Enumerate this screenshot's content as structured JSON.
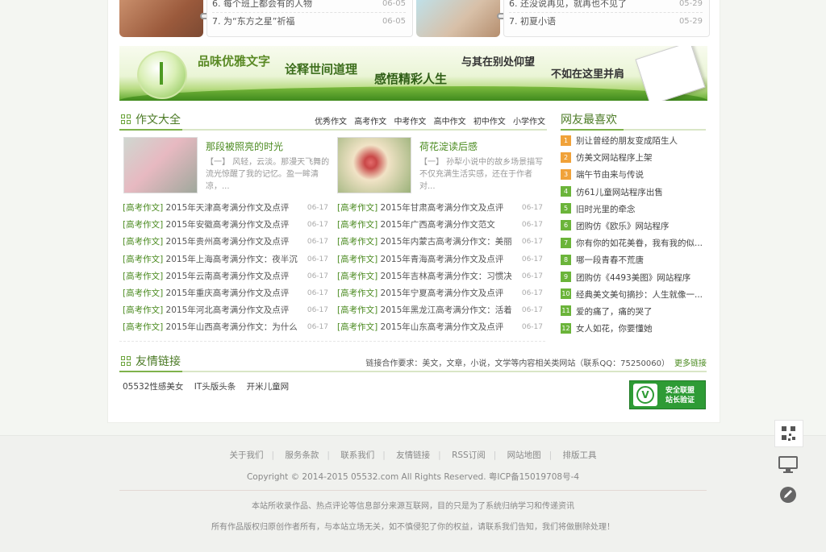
{
  "top_lists": [
    {
      "items": [
        {
          "index": "6.",
          "title": "每个班上都会有的人物",
          "date": "06-05"
        },
        {
          "index": "7.",
          "title": "为“东方之星”祈福",
          "date": "06-05"
        }
      ]
    },
    {
      "items": [
        {
          "index": "6.",
          "title": "还没说再见，就再也不见了",
          "date": "05-29"
        },
        {
          "index": "7.",
          "title": "初夏小语",
          "date": "05-29"
        }
      ]
    }
  ],
  "banner": {
    "line1": "品味优雅文字",
    "line2": "诠释世间道理",
    "line3": "感悟精彩人生",
    "line4": "与其在别处仰望",
    "line5": "不如在这里并肩"
  },
  "essay": {
    "title": "作文大全",
    "tabs": [
      "优秀作文",
      "高考作文",
      "中考作文",
      "高中作文",
      "初中作文",
      "小学作文"
    ],
    "features": [
      {
        "title": "那段被照亮的时光",
        "desc": "【一】 风轻，云淡。那漫天飞舞的流光惊醒了我的记忆。盈一眸清凉，..."
      },
      {
        "title": "荷花淀读后感",
        "desc": "【一】 孙犁小说中的故乡场景描写不仅充满生活实感，还在于作者对..."
      }
    ],
    "left_list": [
      {
        "cat": "[高考作文]",
        "title": "2015年天津高考满分作文及点评",
        "date": "06-17"
      },
      {
        "cat": "[高考作文]",
        "title": "2015年安徽高考满分作文及点评",
        "date": "06-17"
      },
      {
        "cat": "[高考作文]",
        "title": "2015年贵州高考满分作文及点评",
        "date": "06-17"
      },
      {
        "cat": "[高考作文]",
        "title": "2015年上海高考满分作文：夜半沉",
        "date": "06-17"
      },
      {
        "cat": "[高考作文]",
        "title": "2015年云南高考满分作文及点评",
        "date": "06-17"
      },
      {
        "cat": "[高考作文]",
        "title": "2015年重庆高考满分作文及点评",
        "date": "06-17"
      },
      {
        "cat": "[高考作文]",
        "title": "2015年河北高考满分作文及点评",
        "date": "06-17"
      },
      {
        "cat": "[高考作文]",
        "title": "2015年山西高考满分作文：为什么",
        "date": "06-17"
      }
    ],
    "right_list": [
      {
        "cat": "[高考作文]",
        "title": "2015年甘肃高考满分作文及点评",
        "date": "06-17"
      },
      {
        "cat": "[高考作文]",
        "title": "2015年广西高考满分作文范文",
        "date": "06-17"
      },
      {
        "cat": "[高考作文]",
        "title": "2015年内蒙古高考满分作文：美丽",
        "date": "06-17"
      },
      {
        "cat": "[高考作文]",
        "title": "2015年青海高考满分作文及点评",
        "date": "06-17"
      },
      {
        "cat": "[高考作文]",
        "title": "2015年吉林高考满分作文：习惯决",
        "date": "06-17"
      },
      {
        "cat": "[高考作文]",
        "title": "2015年宁夏高考满分作文及点评",
        "date": "06-17"
      },
      {
        "cat": "[高考作文]",
        "title": "2015年黑龙江高考满分作文：活着",
        "date": "06-17"
      },
      {
        "cat": "[高考作文]",
        "title": "2015年山东高考满分作文及点评",
        "date": "06-17"
      }
    ]
  },
  "favorites": {
    "title": "网友最喜欢",
    "items": [
      {
        "num": "1",
        "title": "别让曾经的朋友变成陌生人",
        "color": "#f0a23a"
      },
      {
        "num": "2",
        "title": "仿美文网站程序上架",
        "color": "#f0a23a"
      },
      {
        "num": "3",
        "title": "端午节由来与传说",
        "color": "#f0a23a"
      },
      {
        "num": "4",
        "title": "仿61儿童网站程序出售",
        "color": "#6bb43a"
      },
      {
        "num": "5",
        "title": "旧时光里的牵念",
        "color": "#6bb43a"
      },
      {
        "num": "6",
        "title": "团购仿《欧乐》网站程序",
        "color": "#6bb43a"
      },
      {
        "num": "7",
        "title": "你有你的如花美眷，我有我的似...",
        "color": "#6bb43a"
      },
      {
        "num": "8",
        "title": "哪一段青春不荒唐",
        "color": "#6bb43a"
      },
      {
        "num": "9",
        "title": "团购仿《4493美图》网站程序",
        "color": "#6bb43a"
      },
      {
        "num": "10",
        "title": "经典美文美句摘抄：人生就像一...",
        "color": "#6bb43a"
      },
      {
        "num": "11",
        "title": "爱的痛了，痛的哭了",
        "color": "#6bb43a"
      },
      {
        "num": "12",
        "title": "女人如花，你要懂她",
        "color": "#6bb43a"
      }
    ]
  },
  "friends": {
    "title": "友情链接",
    "note": "链接合作要求：美文，文章，小说，文学等内容相关类网站（联系QQ：75250060）",
    "more": "更多链接",
    "links": [
      "05532性感美女",
      "IT头版头条",
      "开米儿童网"
    ],
    "badge_line1": "安全联盟",
    "badge_line2": "站长验证"
  },
  "footer": {
    "nav": [
      "关于我们",
      "服务条款",
      "联系我们",
      "友情链接",
      "RSS订阅",
      "网站地图",
      "排版工具"
    ],
    "copyright": "Copyright © 2014-2015 05532.com All Rights Reserved. 粤ICP备15019708号-4",
    "notice1": "本站所收录作品、热点评论等信息部分来源互联网，目的只是为了系统归纳学习和传递资讯",
    "notice2": "所有作品版权归原创作者所有，与本站立场无关，如不慎侵犯了你的权益，请联系我们告知，我们将做删除处理！"
  },
  "colors": {
    "accent_green": "#4a8a1f",
    "rank_orange": "#f0a23a",
    "rank_green": "#6bb43a"
  },
  "icons": [
    "grid-icon",
    "qr-code-icon",
    "monitor-icon",
    "edit-icon"
  ]
}
